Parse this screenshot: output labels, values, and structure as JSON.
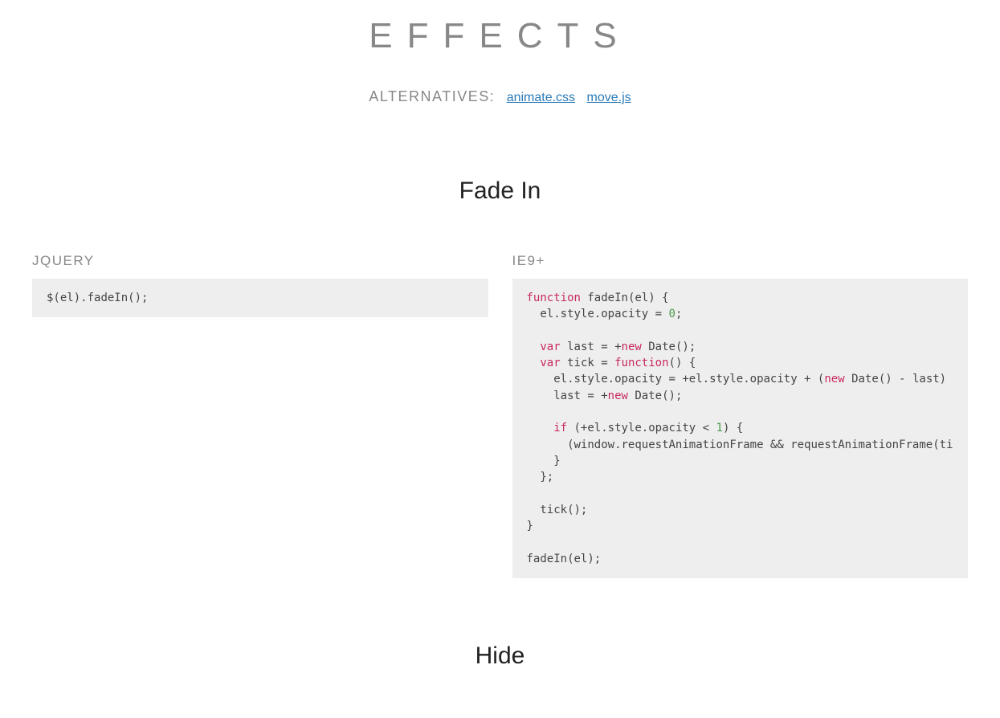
{
  "page": {
    "title": "Effects",
    "alternatives_label": "Alternatives:",
    "alternatives": [
      {
        "label": "animate.css"
      },
      {
        "label": "move.js"
      }
    ]
  },
  "section_fadein": {
    "title": "Fade In",
    "jquery_label": "jQuery",
    "ie9_label": "IE9+",
    "jquery_code": {
      "el": "$(el)",
      "call": ".fadeIn();"
    },
    "ie9_code": {
      "kw_function": "function",
      "fn_name": " fadeIn(el) {",
      "l2": "  el.style.opacity = ",
      "num0": "0",
      "semi": ";",
      "kw_var1": "  var",
      "l4": " last = +",
      "kw_new1": "new",
      "date1": " Date();",
      "kw_var2": "  var",
      "l5a": " tick = ",
      "kw_function2": "function",
      "l5b": "() {",
      "l6a": "    el.style.opacity = +el.style.opacity + (",
      "kw_new2": "new",
      "l6b": " Date() - last) ",
      "l7a": "    last = +",
      "kw_new3": "new",
      "l7b": " Date();",
      "kw_if": "    if",
      "l9a": " (+el.style.opacity < ",
      "num1": "1",
      "l9b": ") {",
      "l10": "      (window.requestAnimationFrame && requestAnimationFrame(ti",
      "l11": "    }",
      "l12": "  };",
      "l14": "  tick();",
      "l15": "}",
      "l17": "fadeIn(el);"
    }
  },
  "section_hide": {
    "title": "Hide"
  }
}
